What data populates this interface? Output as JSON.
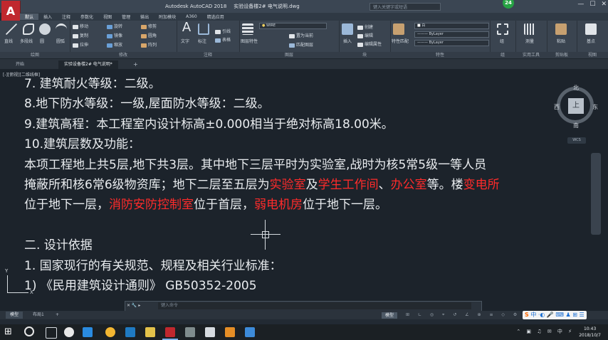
{
  "app": {
    "logo_letter": "A",
    "title": "Autodesk AutoCAD 2018",
    "file_name": "实验设备楼2# 电气说明.dwg",
    "search_placeholder": "键入关键字或短语",
    "badge": "24"
  },
  "menu": {
    "items": [
      "默认",
      "插入",
      "注释",
      "参数化",
      "视图",
      "管理",
      "输出",
      "附加模块",
      "A360",
      "精选应用"
    ],
    "active_index": 0
  },
  "ribbon": {
    "draw": {
      "line": "直线",
      "polyline": "多段线",
      "circle": "圆",
      "arc": "圆弧",
      "label": "绘图"
    },
    "modify": {
      "move": "移动",
      "rotate": "旋转",
      "trim": "修剪",
      "copy": "复制",
      "mirror": "镜像",
      "fillet": "圆角",
      "stretch": "拉伸",
      "scale": "缩放",
      "array": "阵列",
      "label": "修改"
    },
    "annotation": {
      "text": "文字",
      "dimension": "标注",
      "leader": "引线",
      "table": "表格",
      "label": "注释"
    },
    "layers": {
      "layer_props": "图层特性",
      "current_layer": "WIRE",
      "make_current": "置为当前",
      "match_layer": "匹配图层",
      "label": "图层"
    },
    "block": {
      "insert": "插入",
      "create": "创建",
      "edit": "编辑",
      "edit_attr": "编辑属性",
      "label": "块"
    },
    "properties": {
      "match": "特性匹配",
      "color": "白",
      "linetype": "ByLayer",
      "lineweight": "ByLayer",
      "label": "特性"
    },
    "groups": {
      "group": "组",
      "label": "组"
    },
    "utilities": {
      "measure": "测量",
      "label": "实用工具"
    },
    "clipboard": {
      "paste": "粘贴",
      "label": "剪贴板"
    },
    "view": {
      "base": "基点",
      "label": "视图"
    }
  },
  "doc_tabs": [
    "开始",
    "实验设备楼2# 电气说明*"
  ],
  "viewport": {
    "label": "[-][俯视][二维线框]",
    "lines": [
      {
        "parts": [
          {
            "t": "7.  建筑耐火等级：二级。"
          }
        ]
      },
      {
        "parts": [
          {
            "t": "8.地下防水等级：一级,屋面防水等级：二级。"
          }
        ]
      },
      {
        "parts": [
          {
            "t": "9.建筑高程：本工程室内设计标高±0.000相当于绝对标高18.00米。"
          }
        ]
      },
      {
        "parts": [
          {
            "t": "10.建筑层数及功能："
          }
        ]
      },
      {
        "parts": [
          {
            "t": "    本项工程地上共5层,地下共3层。其中地下三层平时为实验室,战时为核5常5级一等人员"
          }
        ]
      },
      {
        "parts": [
          {
            "t": "掩蔽所和核6常6级物资库；地下二层至五层为"
          },
          {
            "t": "实验室",
            "red": true
          },
          {
            "t": "及"
          },
          {
            "t": "学生工作间",
            "red": true
          },
          {
            "t": "、"
          },
          {
            "t": "办公室",
            "red": true
          },
          {
            "t": "等。楼"
          },
          {
            "t": "变电所",
            "red": true
          }
        ]
      },
      {
        "parts": [
          {
            "t": "位于地下一层，"
          },
          {
            "t": "消防安防控制室",
            "red": true
          },
          {
            "t": "位于首层，"
          },
          {
            "t": "弱电机房",
            "red": true
          },
          {
            "t": "位于地下一层。"
          }
        ]
      },
      {
        "parts": [
          {
            "t": ""
          }
        ]
      },
      {
        "parts": [
          {
            "t": "二. 设计依据"
          }
        ]
      },
      {
        "parts": [
          {
            "t": "1. 国家现行的有关规范、规程及相关行业标准："
          }
        ]
      },
      {
        "parts": [
          {
            "t": "1)  《民用建筑设计通则》  GB50352-2005"
          }
        ]
      }
    ],
    "viewcube": {
      "north": "北",
      "south": "南",
      "east": "东",
      "west": "西",
      "face": "上",
      "wcs": "WCS"
    },
    "ucs": {
      "x": "X",
      "y": "Y"
    }
  },
  "command_line": {
    "placeholder": "键入命令",
    "icons": "✕  🔧  ▸"
  },
  "layout_tabs": [
    "模型",
    "布局1",
    "+"
  ],
  "status": {
    "model": "模型",
    "ime": "中"
  },
  "taskbar": {
    "time": "10:43",
    "date": "2018/10/7"
  },
  "colors": {
    "accent": "#c0282e",
    "highlight_text": "#ff2b2b",
    "canvas": "#1c232b"
  }
}
